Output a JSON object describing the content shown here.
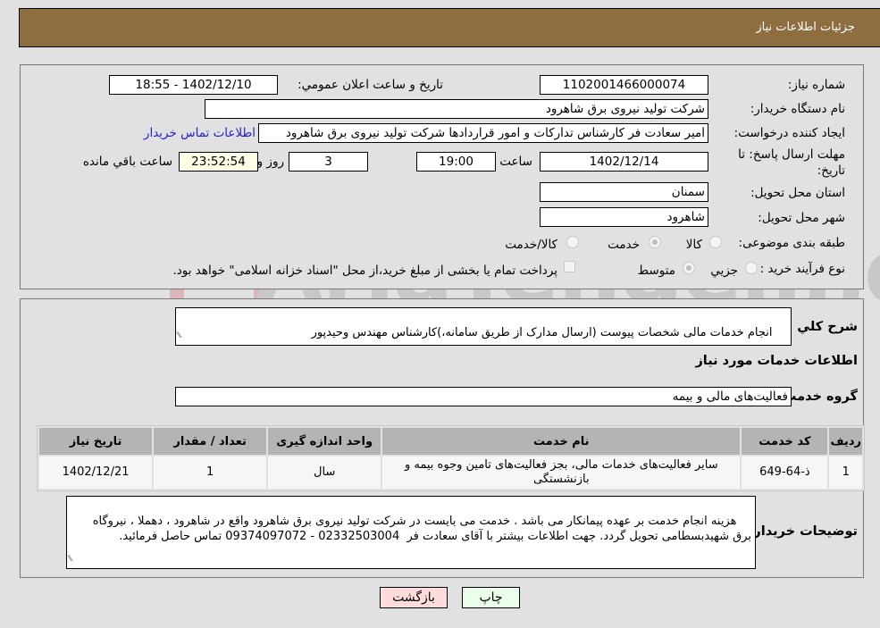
{
  "header": {
    "title": "جزئیات اطلاعات نیاز"
  },
  "watermark": {
    "text": "AriaTender.neT"
  },
  "details": {
    "need_number_label": "شماره نیاز:",
    "need_number": "1102001466000074",
    "announce_label": "تاریخ و ساعت اعلان عمومي:",
    "announce_value": "1402/12/10 - 18:55",
    "buyer_org_label": "نام دستگاه خریدار:",
    "buyer_org": "شرکت تولید نیروی برق شاهرود",
    "creator_label": "ایجاد کننده درخواست:",
    "creator": "امیر سعادت فر کارشناس تدارکات و امور قراردادها شرکت تولید نیروی برق شاهرود",
    "contact_link": "اطلاعات تماس خریدار",
    "deadline_label_1": "مهلت ارسال پاسخ: تا",
    "deadline_label_2": "تاریخ:",
    "deadline_date": "1402/12/14",
    "time_label": "ساعت",
    "deadline_time": "19:00",
    "days": "3",
    "days_label": "روز و",
    "remaining": "23:52:54",
    "remaining_label": "ساعت باقي مانده",
    "province_label": "استان محل تحویل:",
    "province": "سمنان",
    "city_label": "شهر محل تحویل:",
    "city": "شاهرود",
    "category_label": "طبقه بندی موضوعی:",
    "category_options": [
      {
        "label": "کالا",
        "selected": false
      },
      {
        "label": "خدمت",
        "selected": true
      },
      {
        "label": "کالا/خدمت",
        "selected": false
      }
    ],
    "process_label": "نوع فرآیند خرید :",
    "process_options": [
      {
        "label": "جزيي",
        "selected": false
      },
      {
        "label": "متوسط",
        "selected": true
      }
    ],
    "treasury_note": "پرداخت تمام یا بخشی از مبلغ خرید،از محل \"اسناد خزانه اسلامی\" خواهد بود.",
    "treasury_checked": false
  },
  "summary": {
    "description_label": "شرح کلي نیاز:",
    "description": "انجام خدمات مالی شخصات پیوست (ارسال مدارک از طریق سامانه،)کارشناس مهندس وحیدپور",
    "services_heading": "اطلاعات خدمات مورد نیاز",
    "service_group_label": "گروه خدمت:",
    "service_group": "فعالیت‌های مالی و بیمه"
  },
  "table": {
    "headers": [
      "ردیف",
      "کد خدمت",
      "نام خدمت",
      "واحد اندازه گیری",
      "تعداد / مقدار",
      "تاریخ نیاز"
    ],
    "rows": [
      {
        "row": "1",
        "code": "ذ-64-649",
        "name": "سایر فعالیت‌های خدمات مالی، بجز فعالیت‌های تامین وجوه بیمه و بازنشستگی",
        "unit": "سال",
        "qty": "1",
        "date": "1402/12/21"
      }
    ]
  },
  "buyer_notes": {
    "label": "توضیحات خریدار:",
    "text": "هزینه انجام خدمت بر عهده پیمانکار می باشد . خدمت می بایست در شرکت تولید نیروی برق شاهرود واقع در شاهرود ، دهملا ، نیروگاه برق شهیدبسطامی تحویل گردد. جهت اطلاعات بیشتر با آقای سعادت فر  02332503004 - 09374097072 تماس حاصل فرمائید."
  },
  "buttons": {
    "print": "چاپ",
    "back": "بازگشت",
    "print_color": "#eaffea",
    "back_color": "#ffdcdc"
  }
}
